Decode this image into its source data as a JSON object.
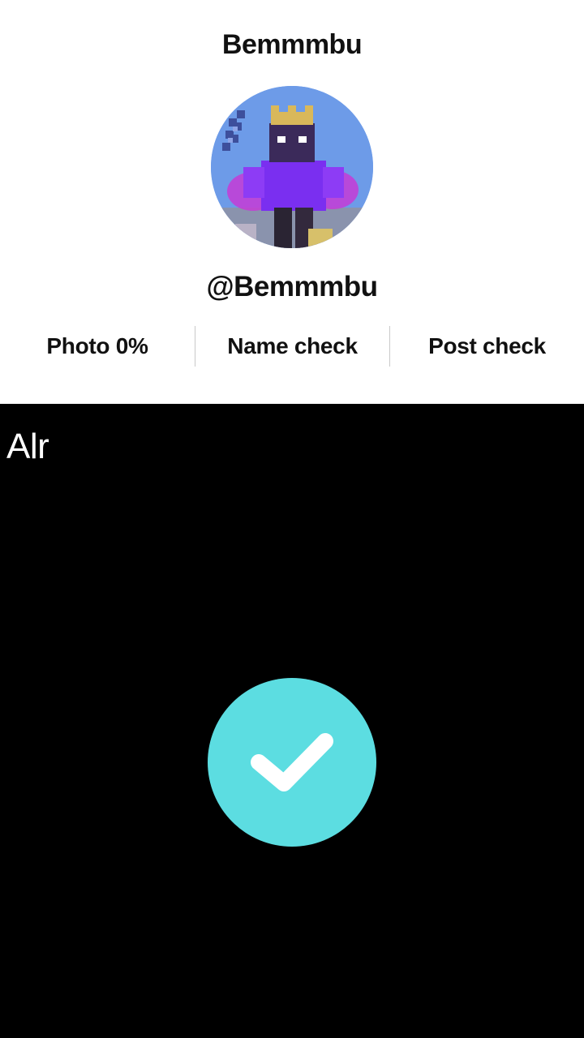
{
  "profile": {
    "display_name": "Bemmmbu",
    "handle": "@Bemmmbu",
    "avatar_icon": "minecraft-character-avatar"
  },
  "stats": [
    {
      "label": "Photo 0%"
    },
    {
      "label": "Name check"
    },
    {
      "label": "Post check"
    }
  ],
  "video": {
    "caption": "Alr",
    "status_icon": "checkmark-icon",
    "accent_color": "#5cdde1"
  }
}
